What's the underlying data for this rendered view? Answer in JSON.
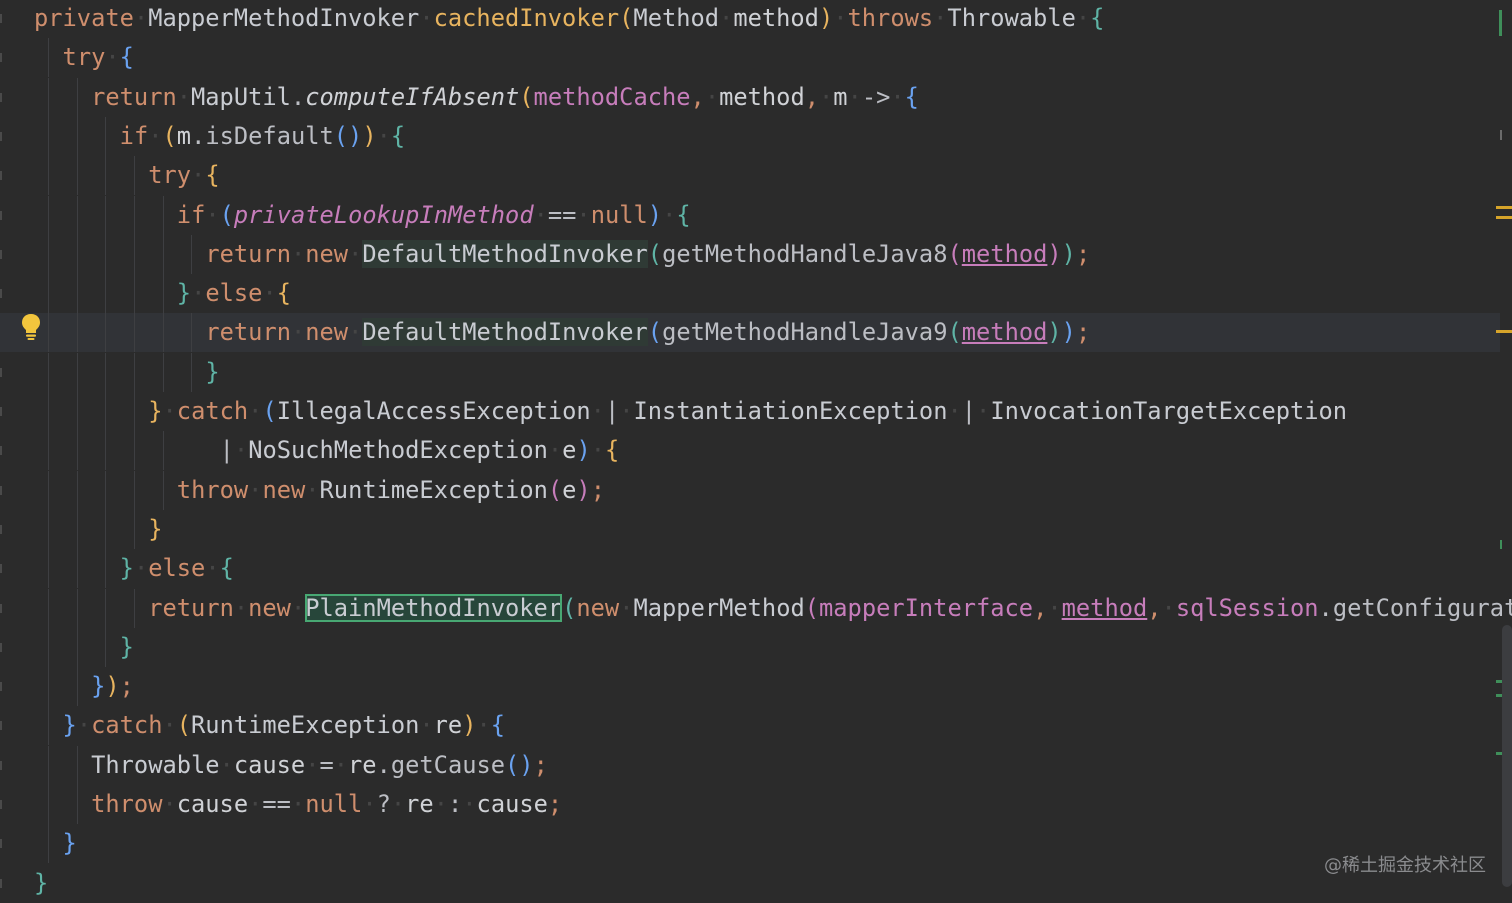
{
  "editor": {
    "language": "Java",
    "colors": {
      "background": "#2b2b2b",
      "keyword": "#cf8e6d",
      "method_declaration": "#e8b45f",
      "field": "#c77dbb",
      "identifier": "#bcbec4",
      "current_line": "#313337",
      "highlight_outline": "#48a873"
    },
    "current_line": 8,
    "lines": [
      {
        "indent": 0,
        "tokens": [
          {
            "t": "private",
            "c": "kw"
          },
          {
            "t": " ",
            "c": "ws"
          },
          {
            "t": "MapperMethodInvoker",
            "c": "typ"
          },
          {
            "t": " ",
            "c": "ws"
          },
          {
            "t": "cachedInvoker",
            "c": "fn"
          },
          {
            "t": "(",
            "c": "b1"
          },
          {
            "t": "Method",
            "c": "typ"
          },
          {
            "t": " ",
            "c": "ws"
          },
          {
            "t": "method",
            "c": "param"
          },
          {
            "t": ")",
            "c": "b1"
          },
          {
            "t": " ",
            "c": "ws"
          },
          {
            "t": "throws",
            "c": "kw"
          },
          {
            "t": " ",
            "c": "ws"
          },
          {
            "t": "Throwable",
            "c": "typ"
          },
          {
            "t": " ",
            "c": "ws"
          },
          {
            "t": "{",
            "c": "b4"
          }
        ]
      },
      {
        "indent": 1,
        "tokens": [
          {
            "t": "try",
            "c": "kw"
          },
          {
            "t": " ",
            "c": "ws"
          },
          {
            "t": "{",
            "c": "b3"
          }
        ]
      },
      {
        "indent": 2,
        "tokens": [
          {
            "t": "return",
            "c": "kw"
          },
          {
            "t": " ",
            "c": "ws"
          },
          {
            "t": "MapUtil",
            "c": "typ"
          },
          {
            "t": ".",
            "c": "plain"
          },
          {
            "t": "computeIfAbsent",
            "c": "static-call"
          },
          {
            "t": "(",
            "c": "b1"
          },
          {
            "t": "methodCache",
            "c": "field"
          },
          {
            "t": ",",
            "c": "semi"
          },
          {
            "t": " ",
            "c": "ws"
          },
          {
            "t": "method",
            "c": "param"
          },
          {
            "t": ",",
            "c": "semi"
          },
          {
            "t": " ",
            "c": "ws"
          },
          {
            "t": "m",
            "c": "param"
          },
          {
            "t": " ",
            "c": "ws"
          },
          {
            "t": "->",
            "c": "plain"
          },
          {
            "t": " ",
            "c": "ws"
          },
          {
            "t": "{",
            "c": "b3"
          }
        ]
      },
      {
        "indent": 3,
        "tokens": [
          {
            "t": "if",
            "c": "kw"
          },
          {
            "t": " ",
            "c": "ws"
          },
          {
            "t": "(",
            "c": "b1"
          },
          {
            "t": "m",
            "c": "param"
          },
          {
            "t": ".",
            "c": "plain"
          },
          {
            "t": "isDefault",
            "c": "plain"
          },
          {
            "t": "()",
            "c": "b3"
          },
          {
            "t": ")",
            "c": "b1"
          },
          {
            "t": " ",
            "c": "ws"
          },
          {
            "t": "{",
            "c": "b4"
          }
        ]
      },
      {
        "indent": 4,
        "tokens": [
          {
            "t": "try",
            "c": "kw"
          },
          {
            "t": " ",
            "c": "ws"
          },
          {
            "t": "{",
            "c": "b1"
          }
        ]
      },
      {
        "indent": 5,
        "tokens": [
          {
            "t": "if",
            "c": "kw"
          },
          {
            "t": " ",
            "c": "ws"
          },
          {
            "t": "(",
            "c": "b3"
          },
          {
            "t": "privateLookupInMethod",
            "c": "static"
          },
          {
            "t": " ",
            "c": "ws"
          },
          {
            "t": "==",
            "c": "plain"
          },
          {
            "t": " ",
            "c": "ws"
          },
          {
            "t": "null",
            "c": "kw"
          },
          {
            "t": ")",
            "c": "b3"
          },
          {
            "t": " ",
            "c": "ws"
          },
          {
            "t": "{",
            "c": "b4"
          }
        ]
      },
      {
        "indent": 6,
        "tokens": [
          {
            "t": "return",
            "c": "kw"
          },
          {
            "t": " ",
            "c": "ws"
          },
          {
            "t": "new",
            "c": "kw"
          },
          {
            "t": " ",
            "c": "ws"
          },
          {
            "t": "DefaultMethodInvoker",
            "c": "typ hl-soft"
          },
          {
            "t": "(",
            "c": "b4"
          },
          {
            "t": "getMethodHandleJava8",
            "c": "plain"
          },
          {
            "t": "(",
            "c": "b2"
          },
          {
            "t": "method",
            "c": "param-link"
          },
          {
            "t": ")",
            "c": "b2"
          },
          {
            "t": ")",
            "c": "b4"
          },
          {
            "t": ";",
            "c": "semi"
          }
        ]
      },
      {
        "indent": 5,
        "tokens": [
          {
            "t": "}",
            "c": "b4"
          },
          {
            "t": " ",
            "c": "ws"
          },
          {
            "t": "else",
            "c": "kw"
          },
          {
            "t": " ",
            "c": "ws"
          },
          {
            "t": "{",
            "c": "b1"
          }
        ]
      },
      {
        "indent": 6,
        "tokens": [
          {
            "t": "return",
            "c": "kw"
          },
          {
            "t": " ",
            "c": "ws"
          },
          {
            "t": "new",
            "c": "kw"
          },
          {
            "t": " ",
            "c": "ws"
          },
          {
            "t": "DefaultMethodInvoker",
            "c": "typ hl-soft"
          },
          {
            "t": "(",
            "c": "b3"
          },
          {
            "t": "getMethodHandleJava9",
            "c": "plain"
          },
          {
            "t": "(",
            "c": "b4"
          },
          {
            "t": "method",
            "c": "param-link"
          },
          {
            "t": ")",
            "c": "b4"
          },
          {
            "t": ")",
            "c": "b3"
          },
          {
            "t": ";",
            "c": "semi"
          }
        ]
      },
      {
        "indent": 6,
        "tokens": [
          {
            "t": "}",
            "c": "b4"
          }
        ]
      },
      {
        "indent": 4,
        "tokens": [
          {
            "t": "}",
            "c": "b1"
          },
          {
            "t": " ",
            "c": "ws"
          },
          {
            "t": "catch",
            "c": "kw"
          },
          {
            "t": " ",
            "c": "ws"
          },
          {
            "t": "(",
            "c": "b3"
          },
          {
            "t": "IllegalAccessException",
            "c": "typ"
          },
          {
            "t": " ",
            "c": "ws"
          },
          {
            "t": "|",
            "c": "plain"
          },
          {
            "t": " ",
            "c": "ws"
          },
          {
            "t": "InstantiationException",
            "c": "typ"
          },
          {
            "t": " ",
            "c": "ws"
          },
          {
            "t": "|",
            "c": "plain"
          },
          {
            "t": " ",
            "c": "ws"
          },
          {
            "t": "InvocationTargetException",
            "c": "typ"
          }
        ]
      },
      {
        "indent": 5,
        "lead": "   ",
        "tokens": [
          {
            "t": "|",
            "c": "plain"
          },
          {
            "t": " ",
            "c": "ws"
          },
          {
            "t": "NoSuchMethodException",
            "c": "typ"
          },
          {
            "t": " ",
            "c": "ws"
          },
          {
            "t": "e",
            "c": "param"
          },
          {
            "t": ")",
            "c": "b3"
          },
          {
            "t": " ",
            "c": "ws"
          },
          {
            "t": "{",
            "c": "b1"
          }
        ]
      },
      {
        "indent": 5,
        "tokens": [
          {
            "t": "throw",
            "c": "kw"
          },
          {
            "t": " ",
            "c": "ws"
          },
          {
            "t": "new",
            "c": "kw"
          },
          {
            "t": " ",
            "c": "ws"
          },
          {
            "t": "RuntimeException",
            "c": "typ"
          },
          {
            "t": "(",
            "c": "b2"
          },
          {
            "t": "e",
            "c": "param"
          },
          {
            "t": ")",
            "c": "b2"
          },
          {
            "t": ";",
            "c": "semi"
          }
        ]
      },
      {
        "indent": 4,
        "tokens": [
          {
            "t": "}",
            "c": "b1"
          }
        ]
      },
      {
        "indent": 3,
        "tokens": [
          {
            "t": "}",
            "c": "b4"
          },
          {
            "t": " ",
            "c": "ws"
          },
          {
            "t": "else",
            "c": "kw"
          },
          {
            "t": " ",
            "c": "ws"
          },
          {
            "t": "{",
            "c": "b4"
          }
        ]
      },
      {
        "indent": 4,
        "tokens": [
          {
            "t": "return",
            "c": "kw"
          },
          {
            "t": " ",
            "c": "ws"
          },
          {
            "t": "new",
            "c": "kw"
          },
          {
            "t": " ",
            "c": "ws"
          },
          {
            "t": "PlainMethodInvoker",
            "c": "typ hl-box"
          },
          {
            "t": "(",
            "c": "b4"
          },
          {
            "t": "new",
            "c": "kw"
          },
          {
            "t": " ",
            "c": "ws"
          },
          {
            "t": "MapperMethod",
            "c": "typ"
          },
          {
            "t": "(",
            "c": "b2"
          },
          {
            "t": "mapperInterface",
            "c": "field"
          },
          {
            "t": ",",
            "c": "semi"
          },
          {
            "t": " ",
            "c": "ws"
          },
          {
            "t": "method",
            "c": "param-link"
          },
          {
            "t": ",",
            "c": "semi"
          },
          {
            "t": " ",
            "c": "ws"
          },
          {
            "t": "sqlSession",
            "c": "field"
          },
          {
            "t": ".",
            "c": "plain"
          },
          {
            "t": "getConfigurat",
            "c": "plain"
          }
        ]
      },
      {
        "indent": 3,
        "tokens": [
          {
            "t": "}",
            "c": "b4"
          }
        ]
      },
      {
        "indent": 2,
        "tokens": [
          {
            "t": "}",
            "c": "b3"
          },
          {
            "t": ")",
            "c": "b1"
          },
          {
            "t": ";",
            "c": "semi"
          }
        ]
      },
      {
        "indent": 1,
        "tokens": [
          {
            "t": "}",
            "c": "b3"
          },
          {
            "t": " ",
            "c": "ws"
          },
          {
            "t": "catch",
            "c": "kw"
          },
          {
            "t": " ",
            "c": "ws"
          },
          {
            "t": "(",
            "c": "b1"
          },
          {
            "t": "RuntimeException",
            "c": "typ"
          },
          {
            "t": " ",
            "c": "ws"
          },
          {
            "t": "re",
            "c": "param"
          },
          {
            "t": ")",
            "c": "b1"
          },
          {
            "t": " ",
            "c": "ws"
          },
          {
            "t": "{",
            "c": "b3"
          }
        ]
      },
      {
        "indent": 2,
        "tokens": [
          {
            "t": "Throwable",
            "c": "typ"
          },
          {
            "t": " ",
            "c": "ws"
          },
          {
            "t": "cause",
            "c": "param"
          },
          {
            "t": " ",
            "c": "ws"
          },
          {
            "t": "=",
            "c": "plain"
          },
          {
            "t": " ",
            "c": "ws"
          },
          {
            "t": "re",
            "c": "param"
          },
          {
            "t": ".",
            "c": "plain"
          },
          {
            "t": "getCause",
            "c": "plain"
          },
          {
            "t": "()",
            "c": "b3"
          },
          {
            "t": ";",
            "c": "semi"
          }
        ]
      },
      {
        "indent": 2,
        "tokens": [
          {
            "t": "throw",
            "c": "kw"
          },
          {
            "t": " ",
            "c": "ws"
          },
          {
            "t": "cause",
            "c": "param"
          },
          {
            "t": " ",
            "c": "ws"
          },
          {
            "t": "==",
            "c": "plain"
          },
          {
            "t": " ",
            "c": "ws"
          },
          {
            "t": "null",
            "c": "kw"
          },
          {
            "t": " ",
            "c": "ws"
          },
          {
            "t": "?",
            "c": "plain"
          },
          {
            "t": " ",
            "c": "ws"
          },
          {
            "t": "re",
            "c": "param"
          },
          {
            "t": " ",
            "c": "ws"
          },
          {
            "t": ":",
            "c": "plain"
          },
          {
            "t": " ",
            "c": "ws"
          },
          {
            "t": "cause",
            "c": "param"
          },
          {
            "t": ";",
            "c": "semi"
          }
        ]
      },
      {
        "indent": 1,
        "tokens": [
          {
            "t": "}",
            "c": "b3"
          }
        ]
      },
      {
        "indent": 0,
        "tokens": [
          {
            "t": "}",
            "c": "b4"
          }
        ]
      }
    ]
  },
  "icons": {
    "intention_bulb": "lightbulb-icon"
  },
  "watermark": "@稀土掘金技术社区"
}
